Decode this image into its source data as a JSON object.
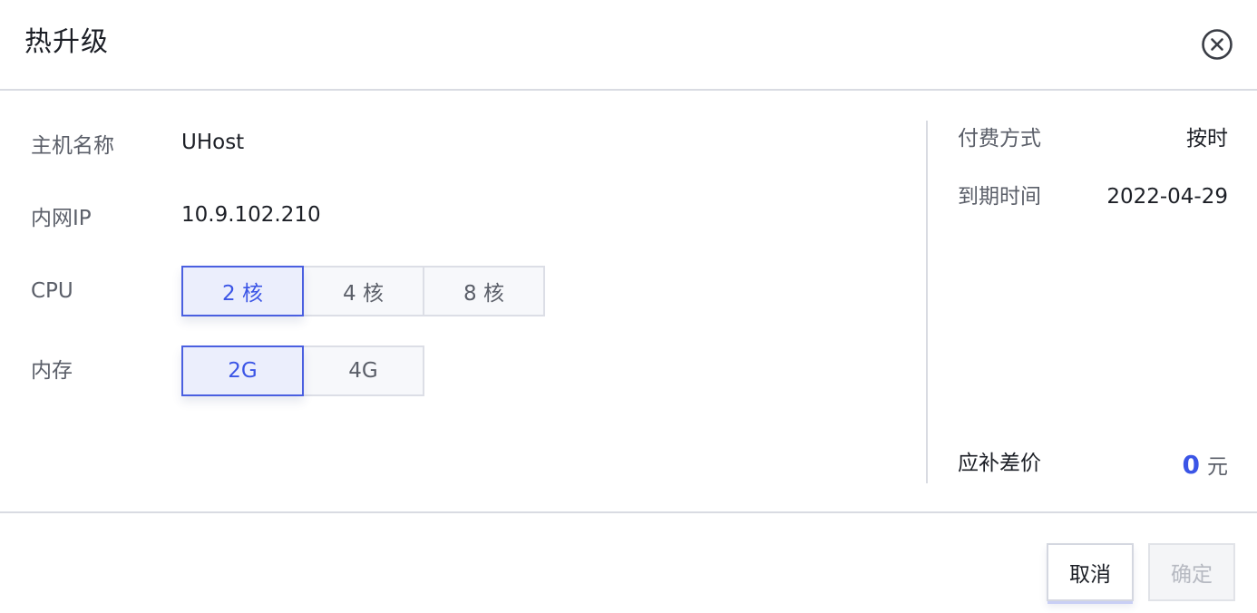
{
  "dialog": {
    "title": "热升级",
    "close_icon": "close-circle-icon"
  },
  "form": {
    "host_name": {
      "label": "主机名称",
      "value": "UHost"
    },
    "private_ip": {
      "label": "内网IP",
      "value": "10.9.102.210"
    },
    "cpu": {
      "label": "CPU",
      "options": [
        "2 核",
        "4 核",
        "8 核"
      ],
      "selected": "2 核"
    },
    "memory": {
      "label": "内存",
      "options": [
        "2G",
        "4G"
      ],
      "selected": "2G"
    }
  },
  "summary": {
    "billing": {
      "label": "付费方式",
      "value": "按时"
    },
    "expire": {
      "label": "到期时间",
      "value": "2022-04-29"
    },
    "diff": {
      "label": "应补差价",
      "amount": "0",
      "unit": "元"
    }
  },
  "footer": {
    "cancel_label": "取消",
    "confirm_label": "确定",
    "confirm_disabled": true
  },
  "colors": {
    "accent": "#3b55e6",
    "border": "#d9dbe2",
    "text_muted": "#5b5f69",
    "disabled_text": "#b6b9c1"
  }
}
